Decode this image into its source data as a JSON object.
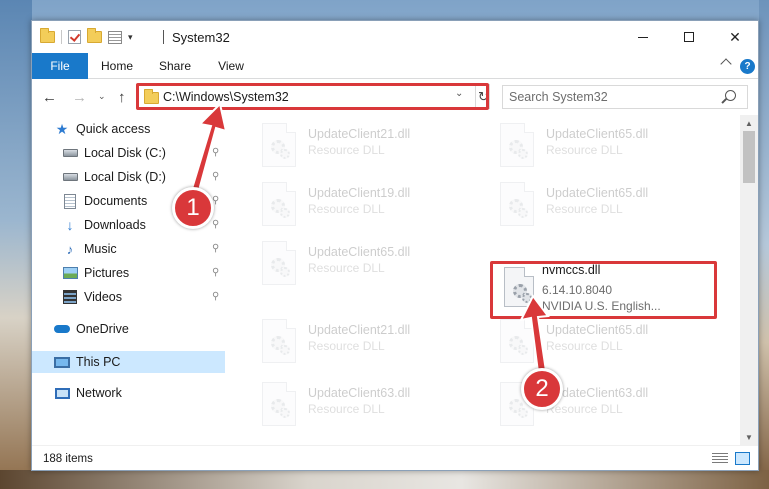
{
  "window": {
    "title": "System32"
  },
  "title_controls": {
    "minimize_icon": "minimize-icon",
    "maximize_icon": "maximize-icon",
    "close_glyph": "✕"
  },
  "ribbon": {
    "tabs": [
      "File",
      "Home",
      "Share",
      "View"
    ],
    "help_glyph": "?"
  },
  "nav": {
    "back_glyph": "←",
    "forward_glyph": "→",
    "recent_glyph": "⌄",
    "up_glyph": "↑",
    "address": "C:\\Windows\\System32",
    "address_dropdown_glyph": "⌄",
    "refresh_glyph": "↻",
    "search_placeholder": "Search System32"
  },
  "sidebar": {
    "items": [
      {
        "label": "Quick access",
        "icon": "star-icon",
        "pinned": false
      },
      {
        "label": "Local Disk (C:)",
        "icon": "drive-icon",
        "pinned": true
      },
      {
        "label": "Local Disk (D:)",
        "icon": "drive-icon",
        "pinned": true
      },
      {
        "label": "Documents",
        "icon": "document-icon",
        "pinned": true
      },
      {
        "label": "Downloads",
        "icon": "download-icon",
        "pinned": true
      },
      {
        "label": "Music",
        "icon": "music-icon",
        "pinned": true
      },
      {
        "label": "Pictures",
        "icon": "pictures-icon",
        "pinned": true
      },
      {
        "label": "Videos",
        "icon": "videos-icon",
        "pinned": true
      },
      {
        "label": "OneDrive",
        "icon": "cloud-icon",
        "pinned": false
      },
      {
        "label": "This PC",
        "icon": "computer-icon",
        "pinned": false,
        "selected": true
      },
      {
        "label": "Network",
        "icon": "network-icon",
        "pinned": false
      }
    ],
    "pin_glyph": "📌"
  },
  "files": [
    {
      "name": "UpdateClient21.dll",
      "line1": "Resource DLL",
      "line2": ""
    },
    {
      "name": "UpdateClient65.dll",
      "line1": "Resource DLL",
      "line2": ""
    },
    {
      "name": "UpdateClient19.dll",
      "line1": "Resource DLL",
      "line2": ""
    },
    {
      "name": "UpdateClient65.dll",
      "line1": "Resource DLL",
      "line2": ""
    },
    {
      "name": "UpdateClient65.dll",
      "line1": "Resource DLL",
      "line2": ""
    },
    {
      "name": "nvmccs.dll",
      "line1": "6.14.10.8040",
      "line2": "NVIDIA U.S. English...",
      "highlighted": true
    },
    {
      "name": "UpdateClient21.dll",
      "line1": "Resource DLL",
      "line2": ""
    },
    {
      "name": "UpdateClient65.dll",
      "line1": "Resource DLL",
      "line2": ""
    },
    {
      "name": "UpdateClient63.dll",
      "line1": "Resource DLL",
      "line2": ""
    },
    {
      "name": "UpdateClient63.dll",
      "line1": "Resource DLL",
      "line2": ""
    }
  ],
  "status": {
    "item_count": "188 items"
  },
  "annotations": {
    "callout_1": "1",
    "callout_2": "2",
    "color": "#d9383a"
  },
  "colors": {
    "accent": "#1979ca",
    "selection": "#cce8ff",
    "annotation_red": "#d9383a"
  }
}
